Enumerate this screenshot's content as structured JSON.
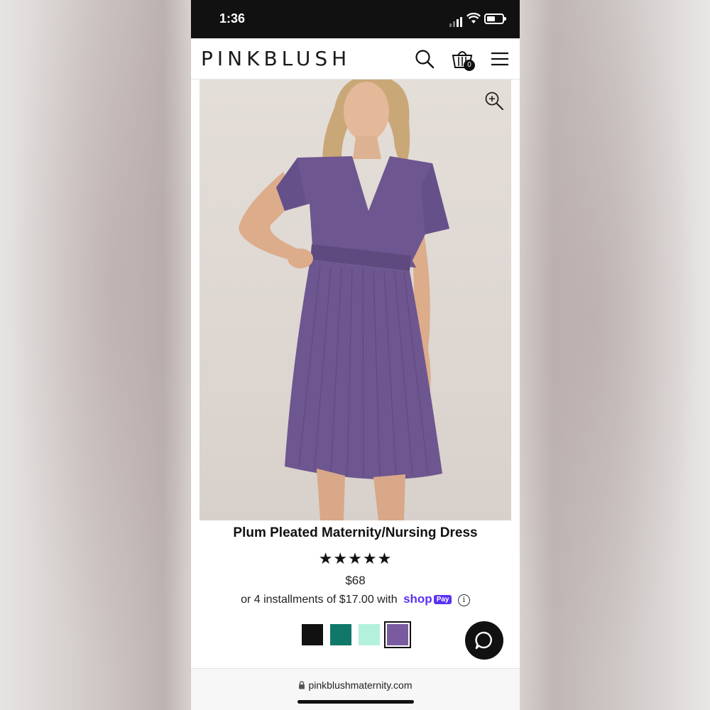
{
  "status_bar": {
    "time": "1:36"
  },
  "header": {
    "logo": "PINKBLUSH",
    "cart_count": "0"
  },
  "product": {
    "title": "Plum Pleated Maternity/Nursing Dress",
    "rating_stars": 5,
    "rating_display": "★★★★★",
    "price": "$68",
    "installments_text": "or 4 installments of $17.00 with",
    "shop_pay_word": "shop",
    "shop_pay_badge": "Pay",
    "info_glyph": "i",
    "dress_color": "#6e5690",
    "swatches": [
      {
        "name": "black",
        "color": "#111111",
        "selected": false
      },
      {
        "name": "teal",
        "color": "#107868",
        "selected": false
      },
      {
        "name": "mint",
        "color": "#b4f1dc",
        "selected": false
      },
      {
        "name": "plum",
        "color": "#7a5ba0",
        "selected": true
      }
    ]
  },
  "browser": {
    "url": "pinkblushmaternity.com"
  },
  "icons": {
    "search": "search-icon",
    "cart": "cart-icon",
    "menu": "menu-icon",
    "zoom": "zoom-in-icon",
    "chat": "chat-icon",
    "lock": "lock-icon"
  }
}
